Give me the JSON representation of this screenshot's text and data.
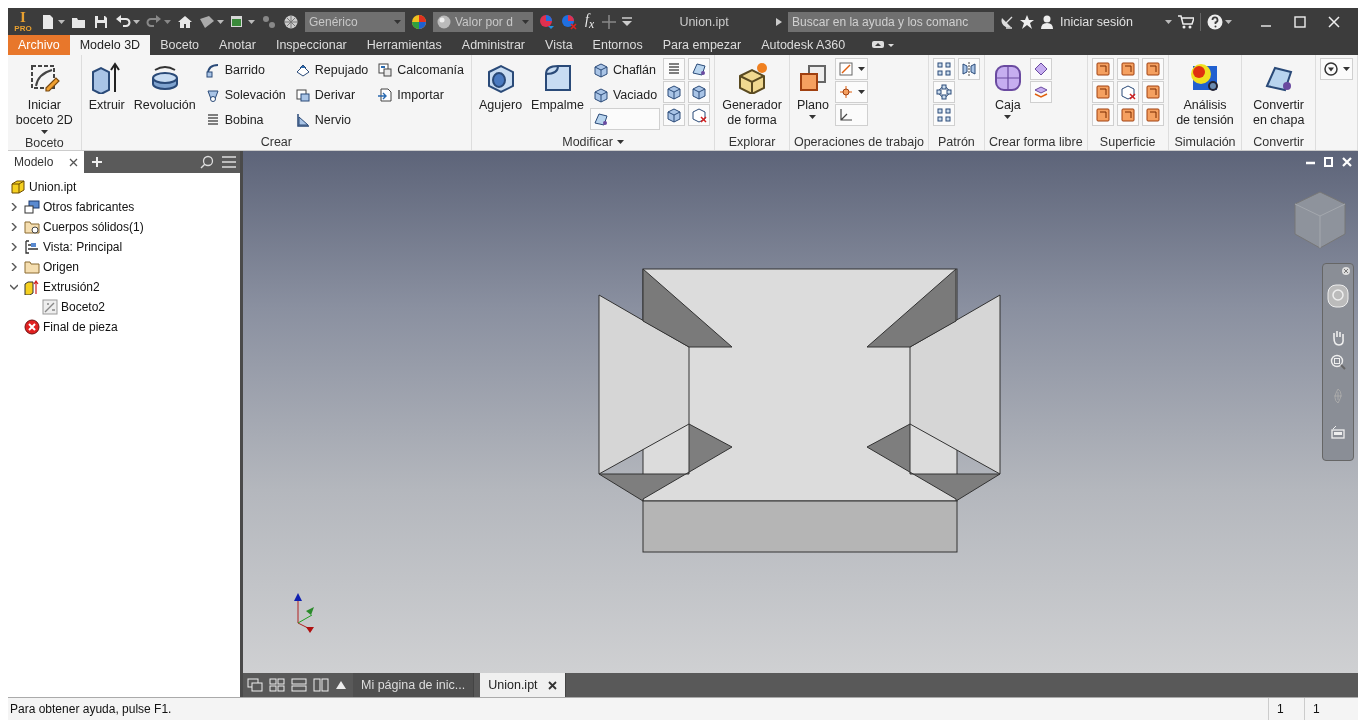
{
  "title_bar": {
    "logo_letter": "I",
    "logo_edition": "PRO",
    "material": "Genérico",
    "appearance": "Valor por d",
    "parameters": "f$_{x}$",
    "title": "Union.ipt",
    "search": {
      "placeholder": "Buscar en la ayuda y los comanc"
    },
    "sign_in": "Iniciar sesión"
  },
  "tabs": [
    {
      "label": "Archivo",
      "kind": "file",
      "selected": false
    },
    {
      "label": "Modelo 3D",
      "kind": "tab",
      "selected": true
    },
    {
      "label": "Boceto",
      "kind": "tab",
      "selected": false
    },
    {
      "label": "Anotar",
      "kind": "tab",
      "selected": false
    },
    {
      "label": "Inspeccionar",
      "kind": "tab",
      "selected": false
    },
    {
      "label": "Herramientas",
      "kind": "tab",
      "selected": false
    },
    {
      "label": "Administrar",
      "kind": "tab",
      "selected": false
    },
    {
      "label": "Vista",
      "kind": "tab",
      "selected": false
    },
    {
      "label": "Entornos",
      "kind": "tab",
      "selected": false
    },
    {
      "label": "Para empezar",
      "kind": "tab",
      "selected": false
    },
    {
      "label": "Autodesk A360",
      "kind": "tab",
      "selected": false
    }
  ],
  "ribbon": {
    "panels": [
      {
        "title": "Boceto",
        "menu": false,
        "groups": [
          {
            "kind": "large",
            "label": "Iniciar boceto 2D",
            "caret": true
          }
        ]
      },
      {
        "title": "Crear",
        "menu": false,
        "groups": [
          {
            "kind": "large",
            "label": "Extruir",
            "caret": false
          },
          {
            "kind": "large",
            "label": "Revolución",
            "caret": false
          },
          {
            "kind": "stack",
            "items": [
              {
                "label": "Barrido"
              },
              {
                "label": "Solevación"
              },
              {
                "label": "Bobina"
              }
            ]
          },
          {
            "kind": "stack",
            "items": [
              {
                "label": "Repujado"
              },
              {
                "label": "Derivar"
              },
              {
                "label": "Nervio"
              }
            ]
          },
          {
            "kind": "stack",
            "items": [
              {
                "label": "Calcomanía"
              },
              {
                "label": "Importar"
              }
            ]
          }
        ]
      },
      {
        "title": "Modificar",
        "menu": true,
        "groups": [
          {
            "kind": "large",
            "label": "Agujero",
            "caret": false
          },
          {
            "kind": "large",
            "label": "Empalme",
            "caret": false
          },
          {
            "kind": "stack",
            "items": [
              {
                "label": "Chaflán"
              },
              {
                "label": "Vaciado"
              },
              {
                "caret": false
              }
            ]
          },
          {
            "kind": "stack",
            "items": [
              {
                "caret": false
              },
              {
                "caret": false
              },
              {
                "caret": false
              }
            ]
          },
          {
            "kind": "stack",
            "items": [
              {
                "caret": false
              },
              {
                "caret": false
              },
              {
                "caret": false
              }
            ]
          }
        ]
      },
      {
        "title": "Explorar",
        "menu": false,
        "groups": [
          {
            "kind": "large",
            "label": "Generador de forma",
            "caret": false
          }
        ]
      },
      {
        "title": "Operaciones de trabajo",
        "menu": false,
        "groups": [
          {
            "kind": "large",
            "label": "Plano",
            "caret": true
          },
          {
            "kind": "stack",
            "items": [
              {
                "caret": true
              },
              {
                "caret": true
              },
              {
                "caret": false
              }
            ]
          }
        ]
      },
      {
        "title": "Patrón",
        "menu": false,
        "groups": [
          {
            "kind": "stack",
            "items": [
              {
                "caret": false
              },
              {
                "caret": false
              },
              {
                "caret": false
              }
            ]
          },
          {
            "kind": "stack",
            "items": [
              {
                "caret": false
              }
            ]
          }
        ]
      },
      {
        "title": "Crear forma libre",
        "menu": false,
        "groups": [
          {
            "kind": "large",
            "label": "Caja",
            "caret": true
          },
          {
            "kind": "stack",
            "items": [
              {
                "caret": false
              },
              {
                "caret": false
              }
            ]
          }
        ]
      },
      {
        "title": "Superficie",
        "menu": false,
        "groups": [
          {
            "kind": "stack",
            "items": [
              {
                "caret": false
              },
              {
                "caret": false
              },
              {
                "caret": false
              }
            ]
          },
          {
            "kind": "stack",
            "items": [
              {
                "caret": false
              },
              {
                "caret": false
              },
              {
                "caret": false
              }
            ]
          },
          {
            "kind": "stack",
            "items": [
              {
                "caret": false
              },
              {
                "caret": false
              },
              {
                "caret": false
              }
            ]
          }
        ]
      },
      {
        "title": "Simulación",
        "menu": false,
        "groups": [
          {
            "kind": "large",
            "label": "Análisis de tensión",
            "caret": false
          }
        ]
      },
      {
        "title": "Convertir",
        "menu": false,
        "groups": [
          {
            "kind": "large",
            "label": "Convertir en chapa",
            "caret": false
          }
        ]
      },
      {
        "groups": [
          {
            "kind": "stack",
            "items": [
              {
                "caret": true
              }
            ]
          }
        ]
      }
    ]
  },
  "browser": {
    "tab": "Modelo",
    "items": [
      {
        "label": "Union.ipt",
        "children": [
          {
            "label": "Otros fabricantes",
            "expanded": false
          },
          {
            "label": "Cuerpos sólidos(1)",
            "expanded": false
          },
          {
            "label": "Vista: Principal",
            "expanded": false
          },
          {
            "label": "Origen",
            "expanded": false
          },
          {
            "label": "Extrusión2",
            "expanded": true,
            "children": [
              {
                "label": "Boceto2"
              }
            ]
          },
          {
            "label": "Final de pieza"
          }
        ]
      }
    ]
  },
  "document_tabs": [
    {
      "label": "Mi página de inic...",
      "selected": false
    },
    {
      "label": "Union.ipt",
      "selected": true
    }
  ],
  "status_bar": {
    "message": "Para obtener ayuda, pulse F1.",
    "cells": [
      "1",
      "1"
    ]
  }
}
